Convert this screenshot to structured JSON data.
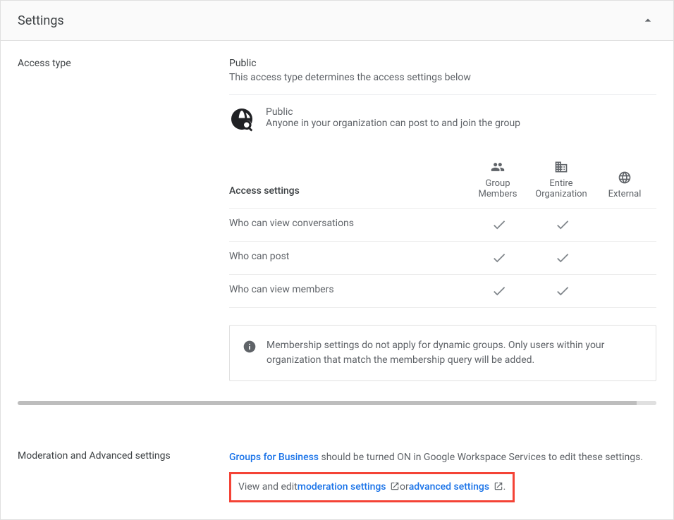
{
  "header": {
    "title": "Settings"
  },
  "access_type": {
    "label": "Access type",
    "value": "Public",
    "description": "This access type determines the access settings below",
    "option": {
      "title": "Public",
      "subtitle": "Anyone in your organization can post to and join the group"
    }
  },
  "access_settings": {
    "heading": "Access settings",
    "columns": [
      {
        "label": "Group Members"
      },
      {
        "label": "Entire Organization"
      },
      {
        "label": "External"
      }
    ],
    "rows": [
      {
        "label": "Who can view conversations",
        "values": [
          true,
          true,
          false
        ]
      },
      {
        "label": "Who can post",
        "values": [
          true,
          true,
          false
        ]
      },
      {
        "label": "Who can view members",
        "values": [
          true,
          true,
          false
        ]
      }
    ]
  },
  "info_notice": "Membership settings do not apply for dynamic groups. Only users within your organization that match the membership query will be added.",
  "moderation": {
    "label": "Moderation and Advanced settings",
    "line1_prefix": " should be turned ON in Google Workspace Services to edit these settings.",
    "gfb": "Groups for Business",
    "line2_prefix": "View and edit ",
    "link_moderation": "moderation settings",
    "line2_or": " or ",
    "link_advanced": "advanced settings",
    "line2_suffix": "."
  }
}
